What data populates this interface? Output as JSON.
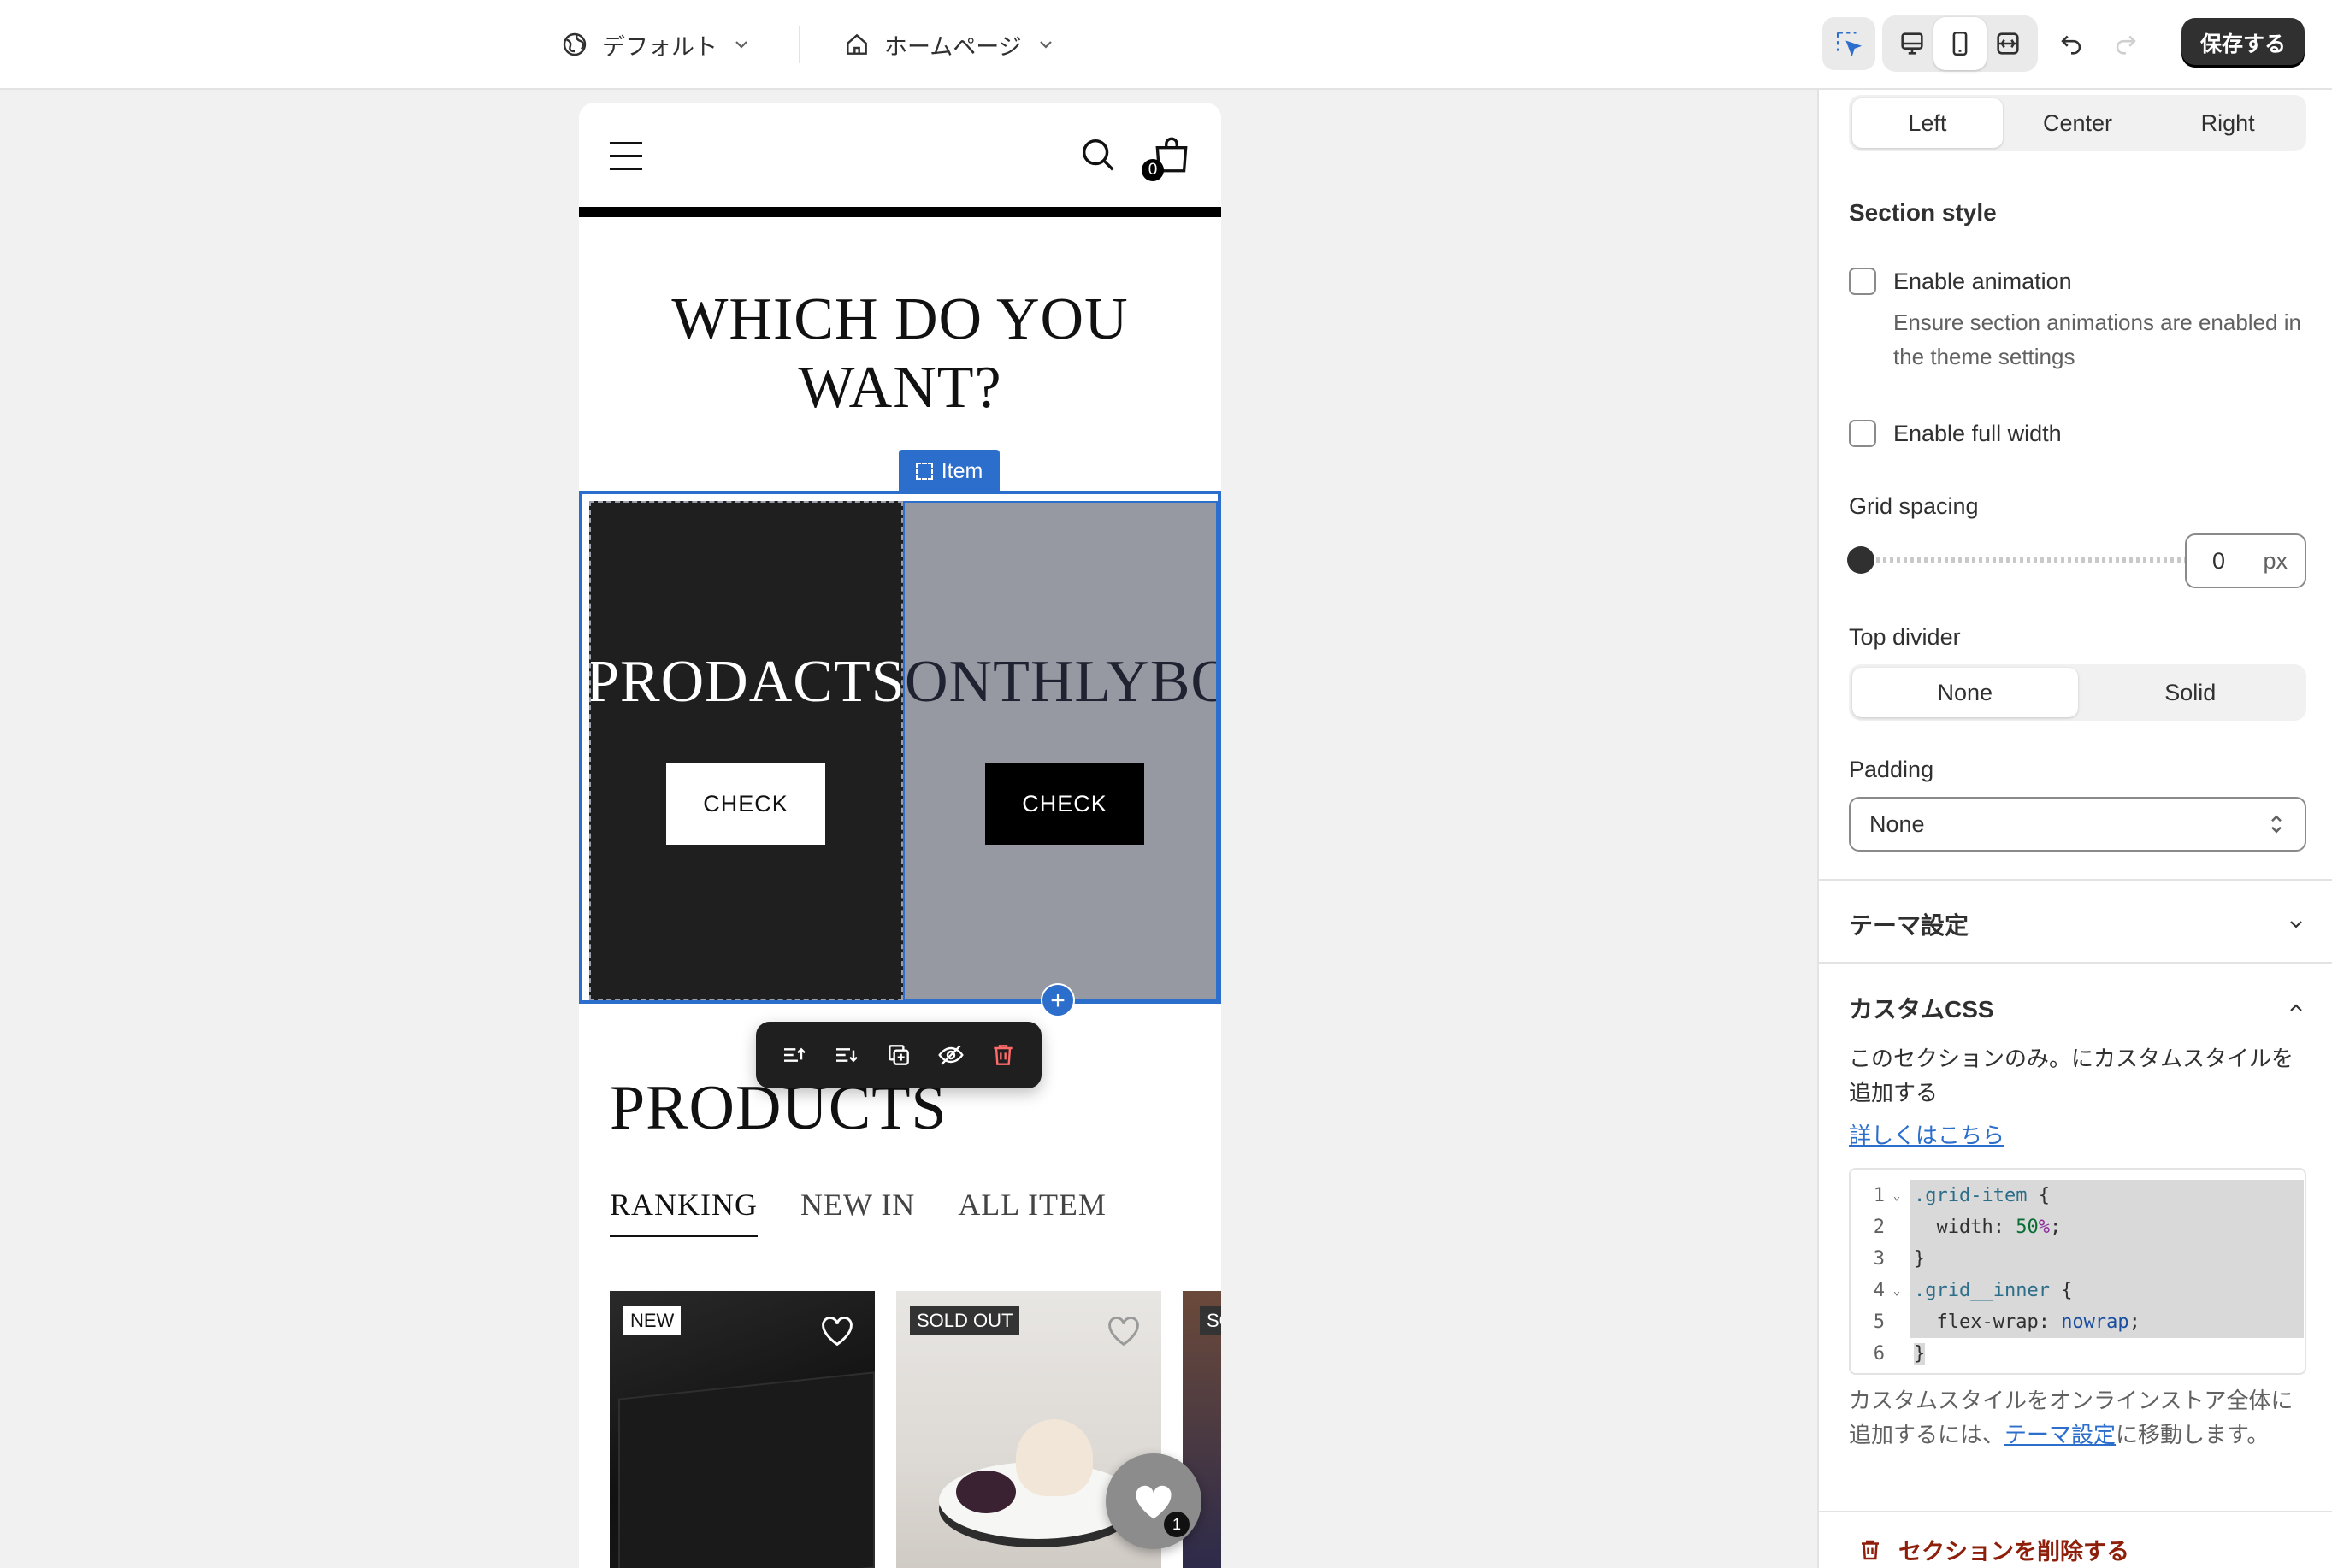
{
  "topbar": {
    "theme_label": "デフォルト",
    "page_label": "ホームページ",
    "save_label": "保存する"
  },
  "preview": {
    "cart_count": "0",
    "title_line1": "WHICH DO YOU",
    "title_line2": "WANT?",
    "selection_tag": "Item",
    "cell_a_text": "PRODACTS",
    "cell_b_text": "ONTHLYBO",
    "cell_a_button": "CHECK",
    "cell_b_button": "CHECK",
    "add_symbol": "+",
    "products_heading": "PRODUCTS",
    "tabs": [
      "RANKING",
      "NEW IN",
      "ALL ITEM"
    ],
    "cards": [
      {
        "badge": "NEW"
      },
      {
        "badge": "SOLD OUT"
      },
      {
        "badge": "SO"
      }
    ],
    "favorites_count": "1"
  },
  "sidebar": {
    "alignment_options": [
      "Left",
      "Center",
      "Right"
    ],
    "section_style_heading": "Section style",
    "enable_animation_label": "Enable animation",
    "enable_animation_help": "Ensure section animations are enabled in the theme settings",
    "enable_full_width_label": "Enable full width",
    "grid_spacing_label": "Grid spacing",
    "grid_spacing_value": "0",
    "grid_spacing_unit": "px",
    "top_divider_label": "Top divider",
    "top_divider_options": [
      "None",
      "Solid"
    ],
    "padding_label": "Padding",
    "padding_value": "None",
    "theme_settings_heading": "テーマ設定",
    "custom_css_heading": "カスタムCSS",
    "custom_css_desc": "このセクションのみ。にカスタムスタイルを追加する",
    "learn_more_link": "詳しくはこちら",
    "code_line_numbers": [
      "1",
      "2",
      "3",
      "4",
      "5",
      "6"
    ],
    "css_note_prefix": "カスタムスタイルをオンラインストア全体に追加するには、",
    "css_note_link": "テーマ設定",
    "css_note_suffix": "に移動します。",
    "delete_section_label": "セクションを削除する"
  }
}
